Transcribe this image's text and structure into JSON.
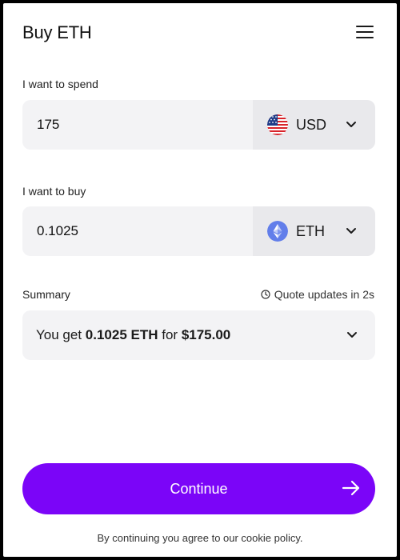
{
  "header": {
    "title": "Buy ETH"
  },
  "spend": {
    "label": "I want to spend",
    "value": "175",
    "currency_code": "USD"
  },
  "buy": {
    "label": "I want to buy",
    "value": "0.1025",
    "currency_code": "ETH"
  },
  "summary": {
    "label": "Summary",
    "quote_status": "Quote updates in 2s",
    "prefix": "You get ",
    "receive_amount": "0.1025 ETH",
    "middle": " for ",
    "total": "$175.00"
  },
  "actions": {
    "continue_label": "Continue"
  },
  "footer": {
    "note": "By continuing you agree to our cookie policy."
  },
  "colors": {
    "primary": "#7b05f8",
    "field_bg": "#f3f3f5",
    "select_bg": "#e9e9ec",
    "eth_icon": "#627eea"
  },
  "icons": {
    "menu": "hamburger-icon",
    "usd": "us-flag-icon",
    "eth": "ethereum-icon",
    "dropdown": "chevron-down-icon",
    "quote": "clock-icon",
    "continue": "arrow-right-icon"
  }
}
